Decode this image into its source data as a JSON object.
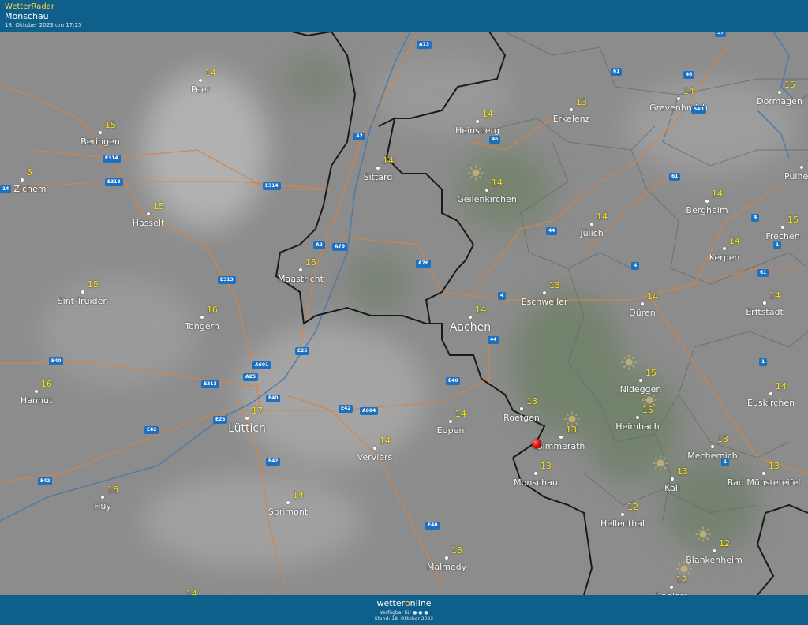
{
  "header": {
    "brand": "WetterRadar",
    "location": "Monschau",
    "timestamp": "18. Oktober 2023 um 17:25"
  },
  "footer": {
    "logo_a": "wetter",
    "logo_b": "o",
    "logo_c": "nline",
    "available": "Verfügbar für",
    "state": "Stand: 18. Oktober 2023"
  },
  "colors": {
    "header_bg": "#0e5f8a",
    "temperature": "#ffe600",
    "road": "#e08a4a",
    "border": "#1a1a1a",
    "river": "#4a78a8",
    "marker": "#d40000"
  },
  "cities": [
    {
      "name": "Peer",
      "temp": "14"
    },
    {
      "name": "Beringen",
      "temp": "15"
    },
    {
      "name": "vel Zichem",
      "temp": "5"
    },
    {
      "name": "Hasselt",
      "temp": "15"
    },
    {
      "name": "Sint-Truiden",
      "temp": "15"
    },
    {
      "name": "Tongern",
      "temp": "16"
    },
    {
      "name": "Hannut",
      "temp": "16"
    },
    {
      "name": "Lüttich",
      "temp": "17"
    },
    {
      "name": "Huy",
      "temp": "16"
    },
    {
      "name": "Sprimont",
      "temp": "14"
    },
    {
      "name": "Verviers",
      "temp": "14"
    },
    {
      "name": "Eupen",
      "temp": "14"
    },
    {
      "name": "Malmedy",
      "temp": "13"
    },
    {
      "name": "Maastricht",
      "temp": "15"
    },
    {
      "name": "Sittard",
      "temp": "14"
    },
    {
      "name": "Heinsberg",
      "temp": "14"
    },
    {
      "name": "Geilenkirchen",
      "temp": "14"
    },
    {
      "name": "Erkelenz",
      "temp": "13"
    },
    {
      "name": "Aachen",
      "temp": "14"
    },
    {
      "name": "Eschweiler",
      "temp": "13"
    },
    {
      "name": "Jülich",
      "temp": "14"
    },
    {
      "name": "Düren",
      "temp": "14"
    },
    {
      "name": "Roetgen",
      "temp": "13"
    },
    {
      "name": "Simmerath",
      "temp": "13"
    },
    {
      "name": "Monschau",
      "temp": "13"
    },
    {
      "name": "Nideggen",
      "temp": "15"
    },
    {
      "name": "Heimbach",
      "temp": "15"
    },
    {
      "name": "Hellenthal",
      "temp": "12"
    },
    {
      "name": "Kall",
      "temp": "13"
    },
    {
      "name": "Mechernich",
      "temp": "13"
    },
    {
      "name": "Bad Münstereifel",
      "temp": "13"
    },
    {
      "name": "Euskirchen",
      "temp": "14"
    },
    {
      "name": "Erftstadt",
      "temp": "14"
    },
    {
      "name": "Blankenheim",
      "temp": "12"
    },
    {
      "name": "Dahlem",
      "temp": "12"
    },
    {
      "name": "Grevenbroich",
      "temp": "14"
    },
    {
      "name": "Dormagen",
      "temp": "15"
    },
    {
      "name": "Pulheim",
      "temp": "15"
    },
    {
      "name": "Bergheim",
      "temp": "14"
    },
    {
      "name": "Frechen",
      "temp": "15"
    },
    {
      "name": "Kerpen",
      "temp": "14"
    }
  ],
  "extra_temps": [
    "14"
  ],
  "roads": [
    "A73",
    "61",
    "46",
    "57",
    "540",
    "46",
    "A2",
    "E314",
    "E313",
    "E314",
    "61",
    "4",
    "44",
    "A2",
    "A79",
    "A76",
    "1",
    "E313",
    "4",
    "61",
    "4",
    "E25",
    "44",
    "E40",
    "A601",
    "E40",
    "E313",
    "A25",
    "E40",
    "E42",
    "A604",
    "E42",
    "E25",
    "E42",
    "E40",
    "1",
    "1",
    "E42",
    "14"
  ]
}
